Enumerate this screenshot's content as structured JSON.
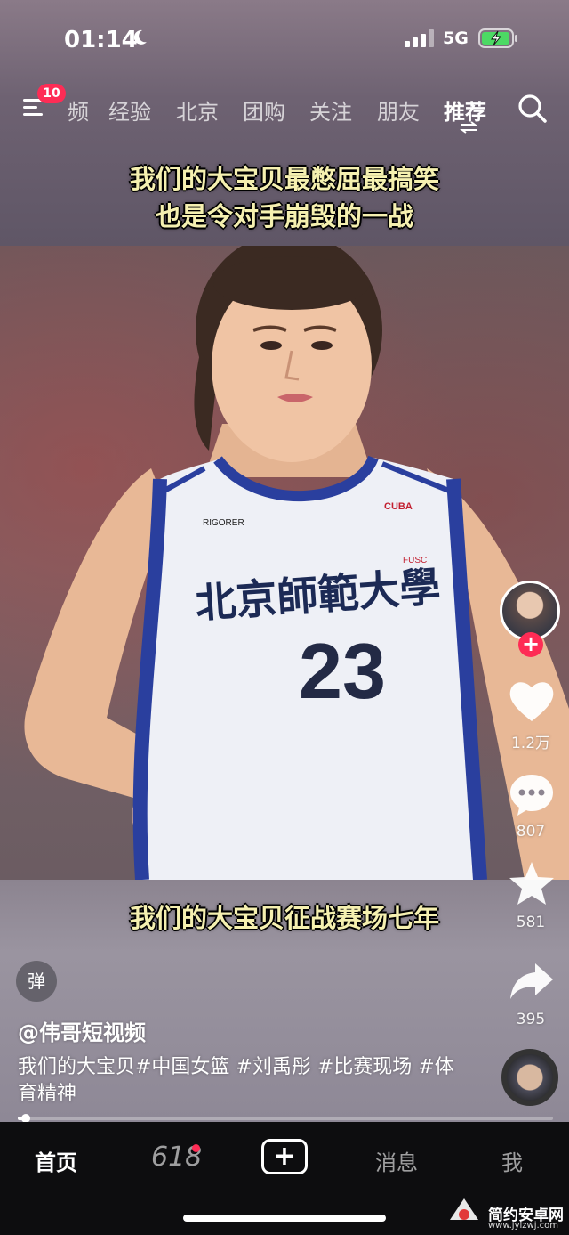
{
  "status_bar": {
    "time": "01:14",
    "network": "5G"
  },
  "top_nav": {
    "badge": "10",
    "tabs": [
      "频",
      "经验",
      "北京",
      "团购",
      "关注",
      "朋友",
      "推荐"
    ],
    "active_tab": "推荐"
  },
  "captions": {
    "line1": "我们的大宝贝最憋屈最搞笑",
    "line2": "也是令对手崩毁的一战",
    "line3": "我们的大宝贝征战赛场七年"
  },
  "jersey": {
    "school": "北京師範大學",
    "number": "23",
    "brand": "RIGORER",
    "league": "CUBA",
    "team": "FUSC"
  },
  "actions": {
    "like_count": "1.2万",
    "comment_count": "807",
    "favorite_count": "581",
    "share_count": "395",
    "follow_symbol": "+"
  },
  "video": {
    "danmu_label": "弹",
    "author": "@伟哥短视频",
    "description": "我们的大宝贝#中国女篮 #刘禹彤 #比赛现场 #体育精神",
    "progress": 0.01
  },
  "tab_bar": {
    "home": "首页",
    "promo": "618",
    "add": "+",
    "messages": "消息",
    "me": "我"
  },
  "watermark": {
    "title": "简约安卓网",
    "url": "www.jylzwj.com"
  },
  "colors": {
    "accent": "#fe2c55",
    "caption": "#f5f0b0",
    "jersey_blue": "#2a3f9e"
  },
  "icons": [
    "moon-icon",
    "signal-icon",
    "battery-charging-icon",
    "menu-icon",
    "search-icon",
    "heart-icon",
    "comment-icon",
    "star-icon",
    "share-icon"
  ]
}
